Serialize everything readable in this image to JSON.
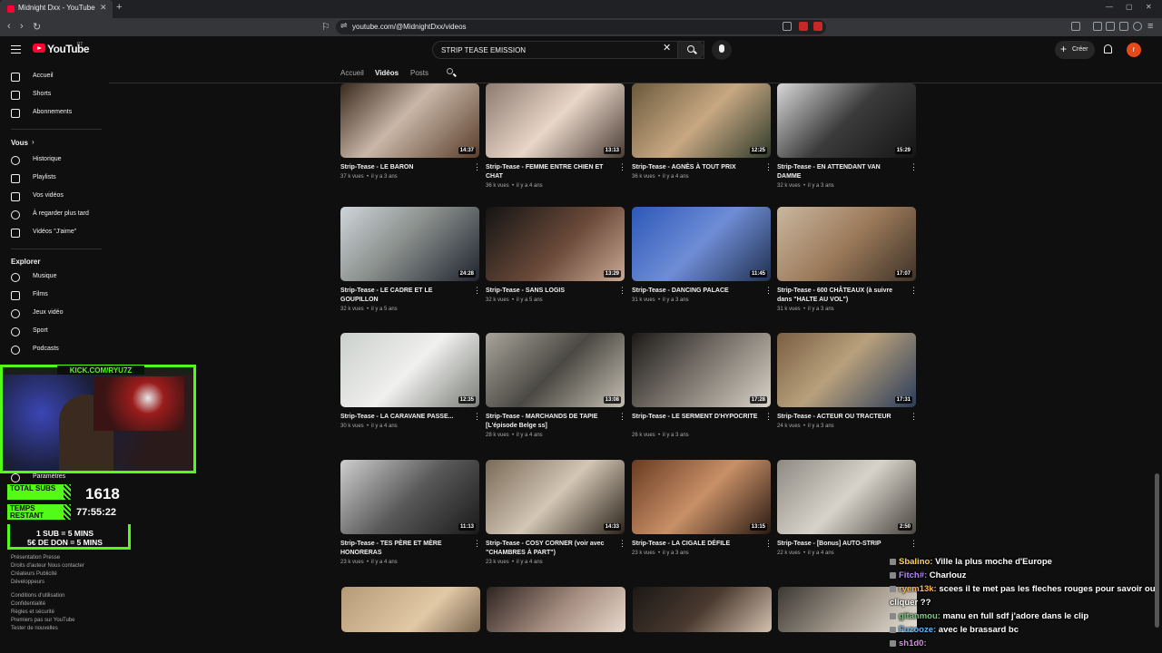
{
  "browser": {
    "tab_title": "Midnight Dxx - YouTube",
    "url": "youtube.com/@MidnightDxx/videos"
  },
  "header": {
    "logo": "YouTube",
    "country": "PT",
    "search_query": "STRIP TEASE EMISSION",
    "create_label": "Créer",
    "avatar_letter": "r"
  },
  "channel_tabs": [
    "Accueil",
    "Vidéos",
    "Posts"
  ],
  "sidebar": {
    "main": [
      "Accueil",
      "Shorts",
      "Abonnements"
    ],
    "you_heading": "Vous",
    "you_chevron": "›",
    "you": [
      "Historique",
      "Playlists",
      "Vos vidéos",
      "À regarder plus tard",
      "Vidéos \"J'aime\""
    ],
    "explore_heading": "Explorer",
    "explore": [
      "Musique",
      "Films",
      "Jeux vidéo",
      "Sport",
      "Podcasts"
    ],
    "settings": "Paramètres",
    "footer": [
      "Présentation  Presse",
      "Droits d'auteur  Nous contacter",
      "Créateurs  Publicité",
      "Développeurs",
      "Conditions d'utilisation",
      "Confidentialité",
      "Règles et sécurité",
      "Premiers pas sur YouTube",
      "Tester de nouvelles"
    ]
  },
  "videos": [
    {
      "title": "Strip-Tease - LE BARON",
      "views": "37 k vues",
      "age": "il y a 3 ans",
      "duration": "14:37"
    },
    {
      "title": "Strip-Tease - FEMME ENTRE CHIEN ET CHAT",
      "views": "36 k vues",
      "age": "il y a 4 ans",
      "duration": "13:13"
    },
    {
      "title": "Strip-Tease - AGNÈS À TOUT PRIX",
      "views": "36 k vues",
      "age": "il y a 4 ans",
      "duration": "12:25"
    },
    {
      "title": "Strip-Tease - EN ATTENDANT VAN DAMME",
      "views": "32 k vues",
      "age": "il y a 3 ans",
      "duration": "15:29"
    },
    {
      "title": "Strip-Tease - LE CADRE ET LE GOUPILLON",
      "views": "32 k vues",
      "age": "il y a 5 ans",
      "duration": "24:28"
    },
    {
      "title": "Strip-Tease - SANS LOGIS",
      "views": "32 k vues",
      "age": "il y a 5 ans",
      "duration": "13:29"
    },
    {
      "title": "Strip-Tease - DANCING PALACE",
      "views": "31 k vues",
      "age": "il y a 3 ans",
      "duration": "11:45"
    },
    {
      "title": "Strip-Tease - 600 CHÂTEAUX (à suivre dans \"HALTE AU VOL\")",
      "views": "31 k vues",
      "age": "il y a 3 ans",
      "duration": "17:07"
    },
    {
      "title": "Strip-Tease - LA CARAVANE PASSE...",
      "views": "30 k vues",
      "age": "il y a 4 ans",
      "duration": "12:35"
    },
    {
      "title": "Strip-Tease - MARCHANDS DE TAPIE [L'épisode Belge ss]",
      "views": "28 k vues",
      "age": "il y a 4 ans",
      "duration": "13:08"
    },
    {
      "title": "Strip-Tease - LE SERMENT D'HYPOCRITE",
      "views": "26 k vues",
      "age": "il y a 3 ans",
      "duration": "17:28"
    },
    {
      "title": "Strip-Tease - ACTEUR OU TRACTEUR",
      "views": "24 k vues",
      "age": "il y a 3 ans",
      "duration": "17:31"
    },
    {
      "title": "Strip-Tease - TES PÈRE ET MÈRE HONORERAS",
      "views": "23 k vues",
      "age": "il y a 4 ans",
      "duration": "11:13"
    },
    {
      "title": "Strip-Tease - COSY CORNER (voir avec \"CHAMBRES À PART\")",
      "views": "23 k vues",
      "age": "il y a 4 ans",
      "duration": "14:33"
    },
    {
      "title": "Strip-Tease - LA CIGALE DÉFILE",
      "views": "23 k vues",
      "age": "il y a 3 ans",
      "duration": "13:15"
    },
    {
      "title": "Strip-Tease - [Bonus] AUTO-STRIP",
      "views": "22 k vues",
      "age": "il y a 4 ans",
      "duration": "2:50"
    }
  ],
  "stream": {
    "kick_label": "KICK.COM/RYU7Z",
    "total_subs_label": "TOTAL SUBS",
    "total_subs_value": "1618",
    "time_label": "TEMPS RESTANT",
    "time_value": "77:55:22",
    "rule1": "1 SUB = 5 MINS",
    "rule2": "5€ DE DON = 5 MINS"
  },
  "chat": [
    {
      "user": "Sbalino:",
      "msg": " Ville la plus moche d'Europe",
      "color": "#ffd54f"
    },
    {
      "user": "Fitch#:",
      "msg": " Charlouz",
      "color": "#b388ff"
    },
    {
      "user": "ryem13k:",
      "msg": " scees il te met pas les fleches rouges pour savoir ou cliquer ??",
      "color": "#ffb74d"
    },
    {
      "user": "gitanmou:",
      "msg": " manu en full sdf j'adore dans le clip",
      "color": "#81c784"
    },
    {
      "user": "Fuzooze:",
      "msg": " avec le brassard bc",
      "color": "#64b5f6"
    },
    {
      "user": "sh1d0:",
      "msg": " ",
      "color": "#ce93d8"
    }
  ],
  "colors": {
    "accent": "#ff0033",
    "kick_green": "#53fc18"
  }
}
